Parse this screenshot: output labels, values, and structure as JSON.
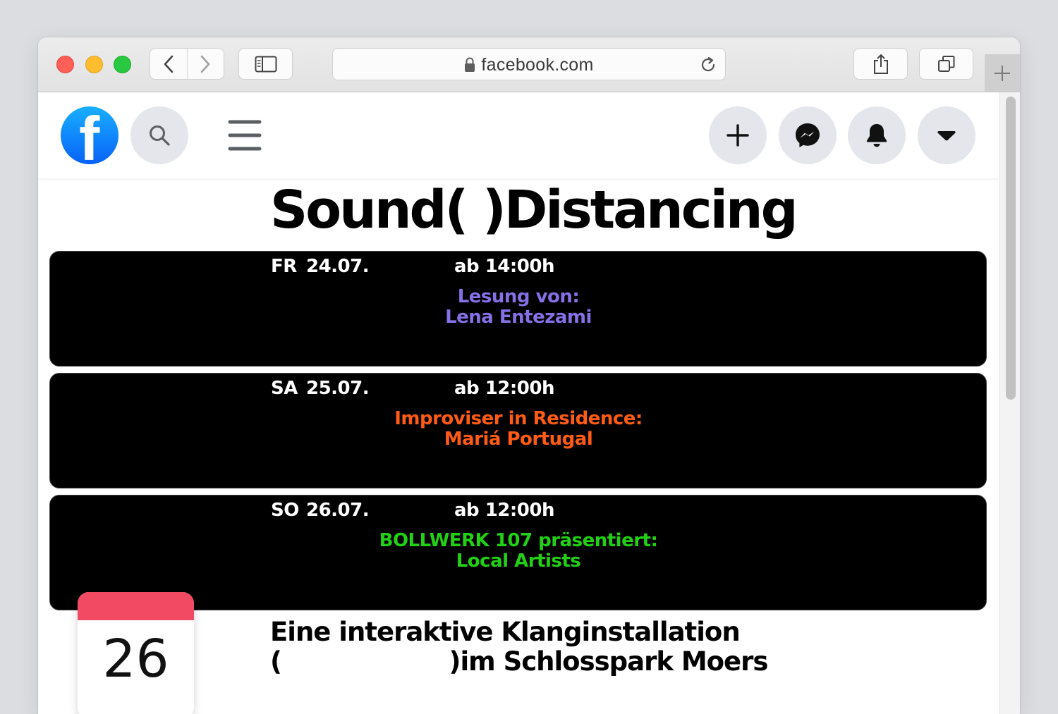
{
  "browser": {
    "url": "facebook.com",
    "traffic_lights": {
      "close": "#fe5f57",
      "minimize": "#febc2e",
      "zoom": "#28c840"
    }
  },
  "facebook": {
    "brand_color": "#1877f2",
    "logo_letter": "f"
  },
  "poster": {
    "title": "Sound( )Distancing",
    "events": [
      {
        "day": "FR",
        "date": "24.07.",
        "time": "ab 14:00h",
        "line1": "Lesung von:",
        "line2": "Lena Entezami",
        "color": "#8570e6"
      },
      {
        "day": "SA",
        "date": "25.07.",
        "time": "ab 12:00h",
        "line1": "Improviser in Residence:",
        "line2": "Mariá Portugal",
        "color": "#ff5b14"
      },
      {
        "day": "SO",
        "date": "26.07.",
        "time": "ab 12:00h",
        "line1": "BOLLWERK 107 präsentiert:",
        "line2": "Local Artists",
        "color": "#22d015"
      }
    ],
    "subtitle_line1": "Eine interaktive Klanginstallation",
    "subtitle_line2": "(                    )im Schlosspark Moers"
  },
  "calendar": {
    "day": "26",
    "accent": "#f24a63"
  }
}
